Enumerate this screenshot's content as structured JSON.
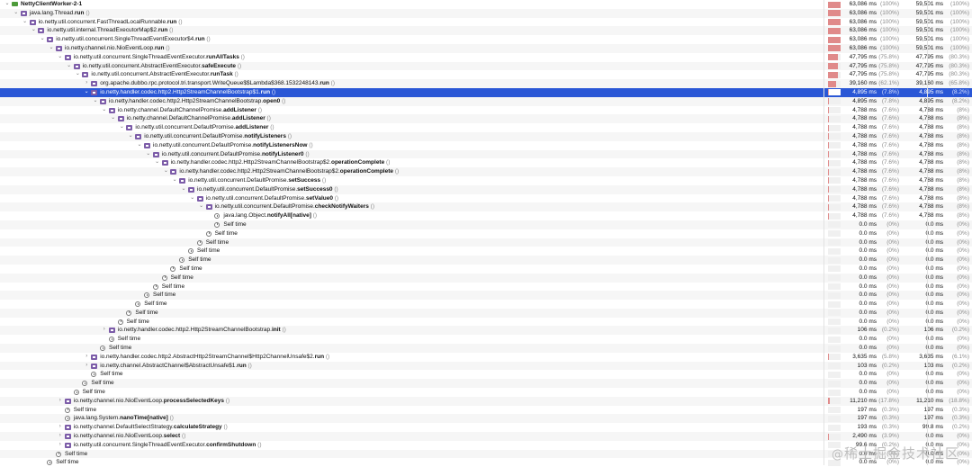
{
  "rows": [
    {
      "depth": 0,
      "toggle": "v",
      "icon": "thread",
      "cls": "",
      "meth": "NettyClientWorker-2-1",
      "args": "",
      "t1": "63,086 ms",
      "p1": "(100%)",
      "t2": "59,501 ms",
      "p2": "(100%)",
      "pct": 100
    },
    {
      "depth": 1,
      "toggle": "v",
      "icon": "method",
      "cls": "java.lang.Thread.",
      "meth": "run",
      "args": " ()",
      "t1": "63,086 ms",
      "p1": "(100%)",
      "t2": "59,501 ms",
      "p2": "(100%)",
      "pct": 100
    },
    {
      "depth": 2,
      "toggle": "v",
      "icon": "method",
      "cls": "io.netty.util.concurrent.FastThreadLocalRunnable.",
      "meth": "run",
      "args": " ()",
      "t1": "63,086 ms",
      "p1": "(100%)",
      "t2": "59,501 ms",
      "p2": "(100%)",
      "pct": 100
    },
    {
      "depth": 3,
      "toggle": "v",
      "icon": "method",
      "cls": "io.netty.util.internal.ThreadExecutorMap$2.",
      "meth": "run",
      "args": " ()",
      "t1": "63,086 ms",
      "p1": "(100%)",
      "t2": "59,501 ms",
      "p2": "(100%)",
      "pct": 100
    },
    {
      "depth": 4,
      "toggle": "v",
      "icon": "method",
      "cls": "io.netty.util.concurrent.SingleThreadEventExecutor$4.",
      "meth": "run",
      "args": " ()",
      "t1": "63,086 ms",
      "p1": "(100%)",
      "t2": "59,501 ms",
      "p2": "(100%)",
      "pct": 100
    },
    {
      "depth": 5,
      "toggle": "v",
      "icon": "method",
      "cls": "io.netty.channel.nio.NioEventLoop.",
      "meth": "run",
      "args": " ()",
      "t1": "63,086 ms",
      "p1": "(100%)",
      "t2": "59,501 ms",
      "p2": "(100%)",
      "pct": 100
    },
    {
      "depth": 6,
      "toggle": "v",
      "icon": "method",
      "cls": "io.netty.util.concurrent.SingleThreadEventExecutor.",
      "meth": "runAllTasks",
      "args": " ()",
      "t1": "47,795 ms",
      "p1": "(75.8%)",
      "t2": "47,795 ms",
      "p2": "(80.3%)",
      "pct": 75.8
    },
    {
      "depth": 7,
      "toggle": "v",
      "icon": "method",
      "cls": "io.netty.util.concurrent.AbstractEventExecutor.",
      "meth": "safeExecute",
      "args": " ()",
      "t1": "47,795 ms",
      "p1": "(75.8%)",
      "t2": "47,795 ms",
      "p2": "(80.3%)",
      "pct": 75.8
    },
    {
      "depth": 8,
      "toggle": "v",
      "icon": "method",
      "cls": "io.netty.util.concurrent.AbstractEventExecutor.",
      "meth": "runTask",
      "args": " ()",
      "t1": "47,795 ms",
      "p1": "(75.8%)",
      "t2": "47,795 ms",
      "p2": "(80.3%)",
      "pct": 75.8
    },
    {
      "depth": 9,
      "toggle": ">",
      "icon": "method",
      "cls": "org.apache.dubbo.rpc.protocol.tri.transport.WriteQueue$$Lambda$368.1532248143.",
      "meth": "run",
      "args": " ()",
      "t1": "39,160 ms",
      "p1": "(62.1%)",
      "t2": "39,160 ms",
      "p2": "(65.8%)",
      "pct": 62.1
    },
    {
      "depth": 9,
      "toggle": "v",
      "icon": "method",
      "cls": "io.netty.handler.codec.http2.Http2StreamChannelBootstrap$1.",
      "meth": "run",
      "args": " ()",
      "t1": "4,895 ms",
      "p1": "(7.8%)",
      "t2": "4,895 ms",
      "p2": "(8.2%)",
      "pct": 7.8,
      "sel": true
    },
    {
      "depth": 10,
      "toggle": "v",
      "icon": "method",
      "cls": "io.netty.handler.codec.http2.Http2StreamChannelBootstrap.",
      "meth": "open0",
      "args": " ()",
      "t1": "4,895 ms",
      "p1": "(7.8%)",
      "t2": "4,895 ms",
      "p2": "(8.2%)",
      "pct": 7.8
    },
    {
      "depth": 11,
      "toggle": "v",
      "icon": "method",
      "cls": "io.netty.channel.DefaultChannelPromise.",
      "meth": "addListener",
      "args": " ()",
      "t1": "4,788 ms",
      "p1": "(7.6%)",
      "t2": "4,788 ms",
      "p2": "(8%)",
      "pct": 7.6
    },
    {
      "depth": 12,
      "toggle": "v",
      "icon": "method",
      "cls": "io.netty.channel.DefaultChannelPromise.",
      "meth": "addListener",
      "args": " ()",
      "t1": "4,788 ms",
      "p1": "(7.6%)",
      "t2": "4,788 ms",
      "p2": "(8%)",
      "pct": 7.6
    },
    {
      "depth": 13,
      "toggle": "v",
      "icon": "method",
      "cls": "io.netty.util.concurrent.DefaultPromise.",
      "meth": "addListener",
      "args": " ()",
      "t1": "4,788 ms",
      "p1": "(7.6%)",
      "t2": "4,788 ms",
      "p2": "(8%)",
      "pct": 7.6
    },
    {
      "depth": 14,
      "toggle": "v",
      "icon": "method",
      "cls": "io.netty.util.concurrent.DefaultPromise.",
      "meth": "notifyListeners",
      "args": " ()",
      "t1": "4,788 ms",
      "p1": "(7.6%)",
      "t2": "4,788 ms",
      "p2": "(8%)",
      "pct": 7.6
    },
    {
      "depth": 15,
      "toggle": "v",
      "icon": "method",
      "cls": "io.netty.util.concurrent.DefaultPromise.",
      "meth": "notifyListenersNow",
      "args": " ()",
      "t1": "4,788 ms",
      "p1": "(7.6%)",
      "t2": "4,788 ms",
      "p2": "(8%)",
      "pct": 7.6
    },
    {
      "depth": 16,
      "toggle": "v",
      "icon": "method",
      "cls": "io.netty.util.concurrent.DefaultPromise.",
      "meth": "notifyListener0",
      "args": " ()",
      "t1": "4,788 ms",
      "p1": "(7.6%)",
      "t2": "4,788 ms",
      "p2": "(8%)",
      "pct": 7.6
    },
    {
      "depth": 17,
      "toggle": "v",
      "icon": "method",
      "cls": "io.netty.handler.codec.http2.Http2StreamChannelBootstrap$2.",
      "meth": "operationComplete",
      "args": " ()",
      "t1": "4,788 ms",
      "p1": "(7.6%)",
      "t2": "4,788 ms",
      "p2": "(8%)",
      "pct": 7.6
    },
    {
      "depth": 18,
      "toggle": "v",
      "icon": "method",
      "cls": "io.netty.handler.codec.http2.Http2StreamChannelBootstrap$2.",
      "meth": "operationComplete",
      "args": " ()",
      "t1": "4,788 ms",
      "p1": "(7.6%)",
      "t2": "4,788 ms",
      "p2": "(8%)",
      "pct": 7.6
    },
    {
      "depth": 19,
      "toggle": "v",
      "icon": "method",
      "cls": "io.netty.util.concurrent.DefaultPromise.",
      "meth": "setSuccess",
      "args": " ()",
      "t1": "4,788 ms",
      "p1": "(7.6%)",
      "t2": "4,788 ms",
      "p2": "(8%)",
      "pct": 7.6
    },
    {
      "depth": 20,
      "toggle": "v",
      "icon": "method",
      "cls": "io.netty.util.concurrent.DefaultPromise.",
      "meth": "setSuccess0",
      "args": " ()",
      "t1": "4,788 ms",
      "p1": "(7.6%)",
      "t2": "4,788 ms",
      "p2": "(8%)",
      "pct": 7.6
    },
    {
      "depth": 21,
      "toggle": "v",
      "icon": "method",
      "cls": "io.netty.util.concurrent.DefaultPromise.",
      "meth": "setValue0",
      "args": " ()",
      "t1": "4,788 ms",
      "p1": "(7.6%)",
      "t2": "4,788 ms",
      "p2": "(8%)",
      "pct": 7.6
    },
    {
      "depth": 22,
      "toggle": "v",
      "icon": "method",
      "cls": "io.netty.util.concurrent.DefaultPromise.",
      "meth": "checkNotifyWaiters",
      "args": " ()",
      "t1": "4,788 ms",
      "p1": "(7.6%)",
      "t2": "4,788 ms",
      "p2": "(8%)",
      "pct": 7.6
    },
    {
      "depth": 23,
      "toggle": "",
      "icon": "clock",
      "cls": "java.lang.Object.",
      "meth": "notifyAll[native]",
      "args": " ()",
      "t1": "4,788 ms",
      "p1": "(7.6%)",
      "t2": "4,788 ms",
      "p2": "(8%)",
      "pct": 7.6
    },
    {
      "depth": 23,
      "toggle": "",
      "icon": "clock",
      "cls": "Self time",
      "meth": "",
      "args": "",
      "t1": "0.0 ms",
      "p1": "(0%)",
      "t2": "0.0 ms",
      "p2": "(0%)",
      "pct": 0
    },
    {
      "depth": 22,
      "toggle": "",
      "icon": "clock",
      "cls": "Self time",
      "meth": "",
      "args": "",
      "t1": "0.0 ms",
      "p1": "(0%)",
      "t2": "0.0 ms",
      "p2": "(0%)",
      "pct": 0
    },
    {
      "depth": 21,
      "toggle": "",
      "icon": "clock",
      "cls": "Self time",
      "meth": "",
      "args": "",
      "t1": "0.0 ms",
      "p1": "(0%)",
      "t2": "0.0 ms",
      "p2": "(0%)",
      "pct": 0
    },
    {
      "depth": 20,
      "toggle": "",
      "icon": "clock",
      "cls": "Self time",
      "meth": "",
      "args": "",
      "t1": "0.0 ms",
      "p1": "(0%)",
      "t2": "0.0 ms",
      "p2": "(0%)",
      "pct": 0
    },
    {
      "depth": 19,
      "toggle": "",
      "icon": "clock",
      "cls": "Self time",
      "meth": "",
      "args": "",
      "t1": "0.0 ms",
      "p1": "(0%)",
      "t2": "0.0 ms",
      "p2": "(0%)",
      "pct": 0
    },
    {
      "depth": 18,
      "toggle": "",
      "icon": "clock",
      "cls": "Self time",
      "meth": "",
      "args": "",
      "t1": "0.0 ms",
      "p1": "(0%)",
      "t2": "0.0 ms",
      "p2": "(0%)",
      "pct": 0
    },
    {
      "depth": 17,
      "toggle": "",
      "icon": "clock",
      "cls": "Self time",
      "meth": "",
      "args": "",
      "t1": "0.0 ms",
      "p1": "(0%)",
      "t2": "0.0 ms",
      "p2": "(0%)",
      "pct": 0
    },
    {
      "depth": 16,
      "toggle": "",
      "icon": "clock",
      "cls": "Self time",
      "meth": "",
      "args": "",
      "t1": "0.0 ms",
      "p1": "(0%)",
      "t2": "0.0 ms",
      "p2": "(0%)",
      "pct": 0
    },
    {
      "depth": 15,
      "toggle": "",
      "icon": "clock",
      "cls": "Self time",
      "meth": "",
      "args": "",
      "t1": "0.0 ms",
      "p1": "(0%)",
      "t2": "0.0 ms",
      "p2": "(0%)",
      "pct": 0
    },
    {
      "depth": 14,
      "toggle": "",
      "icon": "clock",
      "cls": "Self time",
      "meth": "",
      "args": "",
      "t1": "0.0 ms",
      "p1": "(0%)",
      "t2": "0.0 ms",
      "p2": "(0%)",
      "pct": 0
    },
    {
      "depth": 13,
      "toggle": "",
      "icon": "clock",
      "cls": "Self time",
      "meth": "",
      "args": "",
      "t1": "0.0 ms",
      "p1": "(0%)",
      "t2": "0.0 ms",
      "p2": "(0%)",
      "pct": 0
    },
    {
      "depth": 12,
      "toggle": "",
      "icon": "clock",
      "cls": "Self time",
      "meth": "",
      "args": "",
      "t1": "0.0 ms",
      "p1": "(0%)",
      "t2": "0.0 ms",
      "p2": "(0%)",
      "pct": 0
    },
    {
      "depth": 11,
      "toggle": ">",
      "icon": "method",
      "cls": "io.netty.handler.codec.http2.Http2StreamChannelBootstrap.",
      "meth": "init",
      "args": " ()",
      "t1": "106 ms",
      "p1": "(0.2%)",
      "t2": "106 ms",
      "p2": "(0.2%)",
      "pct": 0.2
    },
    {
      "depth": 11,
      "toggle": "",
      "icon": "clock",
      "cls": "Self time",
      "meth": "",
      "args": "",
      "t1": "0.0 ms",
      "p1": "(0%)",
      "t2": "0.0 ms",
      "p2": "(0%)",
      "pct": 0
    },
    {
      "depth": 10,
      "toggle": "",
      "icon": "clock",
      "cls": "Self time",
      "meth": "",
      "args": "",
      "t1": "0.0 ms",
      "p1": "(0%)",
      "t2": "0.0 ms",
      "p2": "(0%)",
      "pct": 0
    },
    {
      "depth": 9,
      "toggle": ">",
      "icon": "method",
      "cls": "io.netty.handler.codec.http2.AbstractHttp2StreamChannel$Http2ChannelUnsafe$2.",
      "meth": "run",
      "args": " ()",
      "t1": "3,635 ms",
      "p1": "(5.8%)",
      "t2": "3,635 ms",
      "p2": "(6.1%)",
      "pct": 5.8
    },
    {
      "depth": 9,
      "toggle": ">",
      "icon": "method",
      "cls": "io.netty.channel.AbstractChannel$AbstractUnsafe$1.",
      "meth": "run",
      "args": " ()",
      "t1": "103 ms",
      "p1": "(0.2%)",
      "t2": "103 ms",
      "p2": "(0.2%)",
      "pct": 0.2
    },
    {
      "depth": 9,
      "toggle": "",
      "icon": "clock",
      "cls": "Self time",
      "meth": "",
      "args": "",
      "t1": "0.0 ms",
      "p1": "(0%)",
      "t2": "0.0 ms",
      "p2": "(0%)",
      "pct": 0
    },
    {
      "depth": 8,
      "toggle": "",
      "icon": "clock",
      "cls": "Self time",
      "meth": "",
      "args": "",
      "t1": "0.0 ms",
      "p1": "(0%)",
      "t2": "0.0 ms",
      "p2": "(0%)",
      "pct": 0
    },
    {
      "depth": 7,
      "toggle": "",
      "icon": "clock",
      "cls": "Self time",
      "meth": "",
      "args": "",
      "t1": "0.0 ms",
      "p1": "(0%)",
      "t2": "0.0 ms",
      "p2": "(0%)",
      "pct": 0
    },
    {
      "depth": 6,
      "toggle": ">",
      "icon": "method",
      "cls": "io.netty.channel.nio.NioEventLoop.",
      "meth": "processSelectedKeys",
      "args": " ()",
      "t1": "11,210 ms",
      "p1": "(17.8%)",
      "t2": "11,210 ms",
      "p2": "(18.8%)",
      "pct": 17.8
    },
    {
      "depth": 6,
      "toggle": "",
      "icon": "clock",
      "cls": "Self time",
      "meth": "",
      "args": "",
      "t1": "197 ms",
      "p1": "(0.3%)",
      "t2": "197 ms",
      "p2": "(0.3%)",
      "pct": 0.3
    },
    {
      "depth": 6,
      "toggle": "",
      "icon": "clock",
      "cls": "java.lang.System.",
      "meth": "nanoTime[native]",
      "args": " ()",
      "t1": "197 ms",
      "p1": "(0.3%)",
      "t2": "197 ms",
      "p2": "(0.3%)",
      "pct": 0.3
    },
    {
      "depth": 6,
      "toggle": ">",
      "icon": "method",
      "cls": "io.netty.channel.DefaultSelectStrategy.",
      "meth": "calculateStrategy",
      "args": " ()",
      "t1": "193 ms",
      "p1": "(0.3%)",
      "t2": "99.8 ms",
      "p2": "(0.2%)",
      "pct": 0.3
    },
    {
      "depth": 6,
      "toggle": ">",
      "icon": "method",
      "cls": "io.netty.channel.nio.NioEventLoop.",
      "meth": "select",
      "args": " ()",
      "t1": "2,490 ms",
      "p1": "(3.9%)",
      "t2": "0.0 ms",
      "p2": "(0%)",
      "pct": 3.9
    },
    {
      "depth": 6,
      "toggle": ">",
      "icon": "method",
      "cls": "io.netty.util.concurrent.SingleThreadEventExecutor.",
      "meth": "confirmShutdown",
      "args": " ()",
      "t1": "99.6 ms",
      "p1": "(0.2%)",
      "t2": "0.0 ms",
      "p2": "(0%)",
      "pct": 0.2
    },
    {
      "depth": 5,
      "toggle": "",
      "icon": "clock",
      "cls": "Self time",
      "meth": "",
      "args": "",
      "t1": "0.0 ms",
      "p1": "(0%)",
      "t2": "0.0 ms",
      "p2": "(0%)",
      "pct": 0
    },
    {
      "depth": 4,
      "toggle": "",
      "icon": "clock",
      "cls": "Self time",
      "meth": "",
      "args": "",
      "t1": "0.0 ms",
      "p1": "(0%)",
      "t2": "0.0 ms",
      "p2": "(0%)",
      "pct": 0
    }
  ],
  "watermark": {
    "at": "@",
    "text": "稀土掘金技术社区"
  },
  "colors": {
    "selected": "#2a57d6",
    "bar": "#e08a8a"
  }
}
